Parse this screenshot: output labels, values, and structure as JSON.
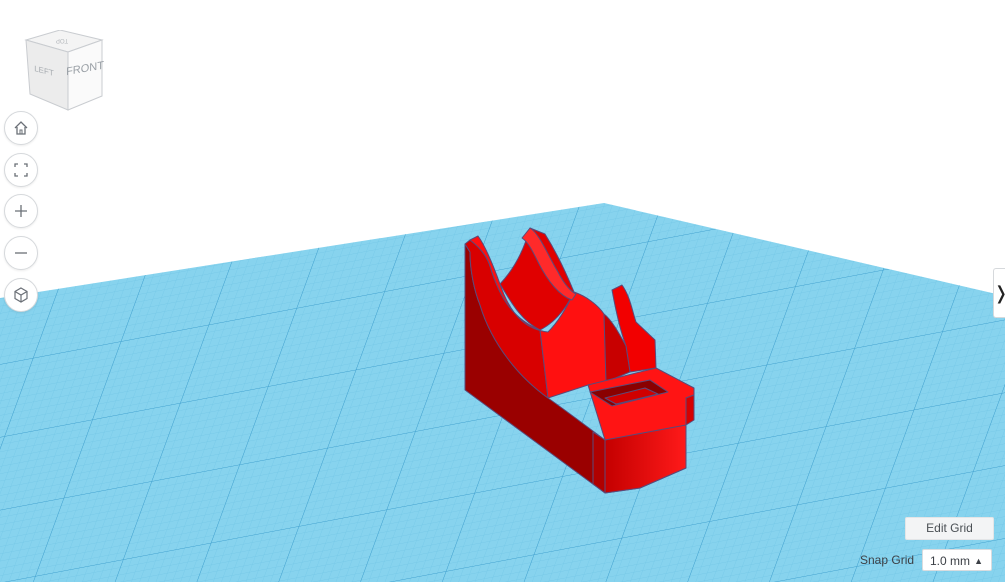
{
  "viewcube": {
    "front_label": "FRONT",
    "left_label": "LEFT",
    "top_label": "TOP"
  },
  "nav": [
    {
      "name": "home-view-button",
      "icon": "home-icon"
    },
    {
      "name": "fit-view-button",
      "icon": "fit-frame-icon"
    },
    {
      "name": "zoom-in-button",
      "icon": "plus-icon"
    },
    {
      "name": "zoom-out-button",
      "icon": "minus-icon"
    },
    {
      "name": "projection-button",
      "icon": "cube-icon"
    }
  ],
  "grid": {
    "edit_label": "Edit Grid",
    "snap_label": "Snap Grid",
    "snap_value": "1.0 mm",
    "snap_caret": "▲"
  },
  "side_panel": {
    "toggle_glyph": "❭"
  },
  "colors": {
    "workplane": "#87d3ee",
    "grid_minor": "#6ec3e4",
    "grid_major": "#2f93c6",
    "model": "#e60000",
    "model_dark": "#9a0000"
  }
}
